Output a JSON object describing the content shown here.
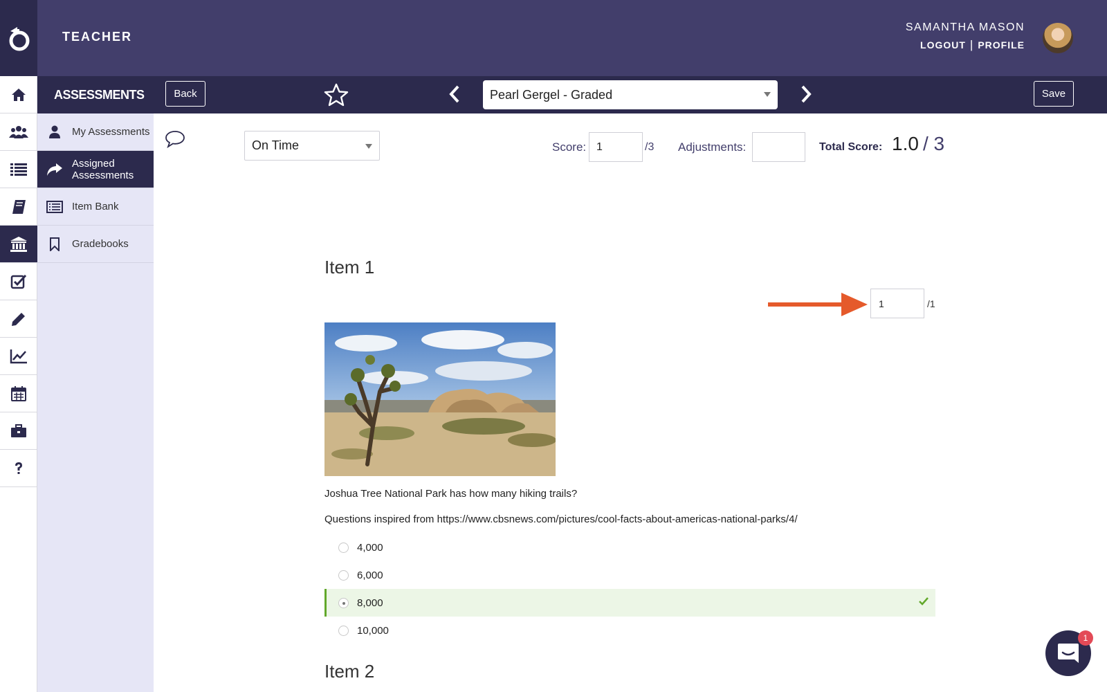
{
  "header": {
    "app_title": "TEACHER",
    "user_name": "SAMANTHA MASON",
    "logout_label": "LOGOUT",
    "separator": "|",
    "profile_label": "PROFILE"
  },
  "toolbar": {
    "section_title": "ASSESSMENTS",
    "back_label": "Back",
    "save_label": "Save",
    "student_select_value": "Pearl Gergel - Graded"
  },
  "rail": {
    "icons": [
      "home-icon",
      "users-icon",
      "list-icon",
      "book-icon",
      "bank-icon",
      "checkbox-icon",
      "pencil-icon",
      "chart-icon",
      "calendar-icon",
      "briefcase-icon",
      "help-icon"
    ],
    "active": "bank-icon"
  },
  "subnav": {
    "items": [
      {
        "label": "My Assessments",
        "icon": "user-icon"
      },
      {
        "label": "Assigned Assessments",
        "icon": "share-arrow-icon",
        "active": true
      },
      {
        "label": "Item Bank",
        "icon": "list-box-icon"
      },
      {
        "label": "Gradebooks",
        "icon": "bookmark-icon"
      }
    ]
  },
  "grading": {
    "status_value": "On Time",
    "score_label": "Score:",
    "score_value": "1",
    "score_out_of": "/3",
    "adjustments_label": "Adjustments:",
    "adjustments_value": "",
    "total_label": "Total Score:",
    "total_value": "1.0",
    "total_out_of": "/ 3"
  },
  "items": [
    {
      "title": "Item 1",
      "score_value": "1",
      "score_out_of": "/1",
      "question": "Joshua Tree National Park has how many hiking trails?",
      "source": "Questions inspired from https://www.cbsnews.com/pictures/cool-facts-about-americas-national-parks/4/",
      "choices": [
        "4,000",
        "6,000",
        "8,000",
        "10,000"
      ],
      "correct_index": 2
    },
    {
      "title": "Item 2"
    }
  ],
  "chat": {
    "badge_count": "1"
  },
  "colors": {
    "header": "#423e6b",
    "nav_dark": "#2c2a4d",
    "subnav": "#e6e6f6",
    "correct_bg": "#ecf6e6",
    "correct_accent": "#62a82b",
    "annotation_arrow": "#e55a2b",
    "badge": "#e34a57"
  }
}
